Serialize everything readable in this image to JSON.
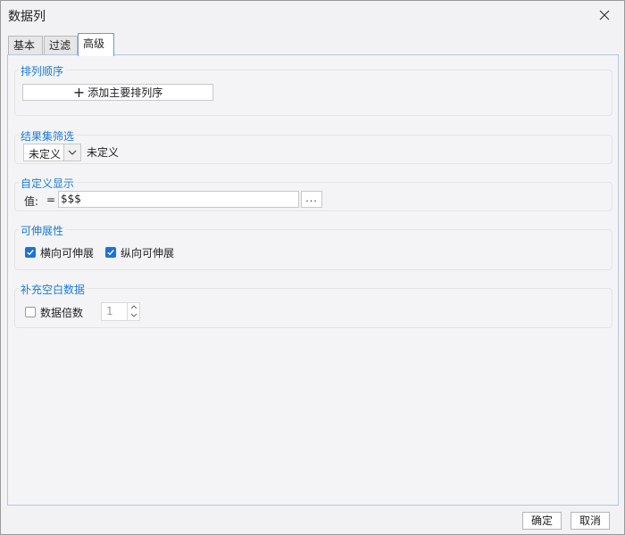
{
  "window": {
    "title": "数据列"
  },
  "tabs": [
    {
      "label": "基本"
    },
    {
      "label": "过滤"
    },
    {
      "label": "高级",
      "active": true
    }
  ],
  "sort_order": {
    "title": "排列顺序",
    "add_button_label": "添加主要排列序"
  },
  "result_filter": {
    "title": "结果集筛选",
    "select_value": "未定义",
    "description": "未定义"
  },
  "custom_display": {
    "title": "自定义显示",
    "value_label": "值:",
    "equals_sign": "=",
    "value": "$$$",
    "ellipsis_label": "..."
  },
  "expandable": {
    "title": "可伸展性",
    "horizontal": {
      "label": "横向可伸展",
      "checked": true
    },
    "vertical": {
      "label": "纵向可伸展",
      "checked": true
    }
  },
  "fill_blank": {
    "title": "补充空白数据",
    "multiple": {
      "label": "数据倍数",
      "checked": false,
      "value": "1"
    }
  },
  "footer": {
    "ok_label": "确定",
    "cancel_label": "取消"
  },
  "colors": {
    "accent": "#1a7bd6",
    "checkbox_checked": "#1a73d9"
  }
}
